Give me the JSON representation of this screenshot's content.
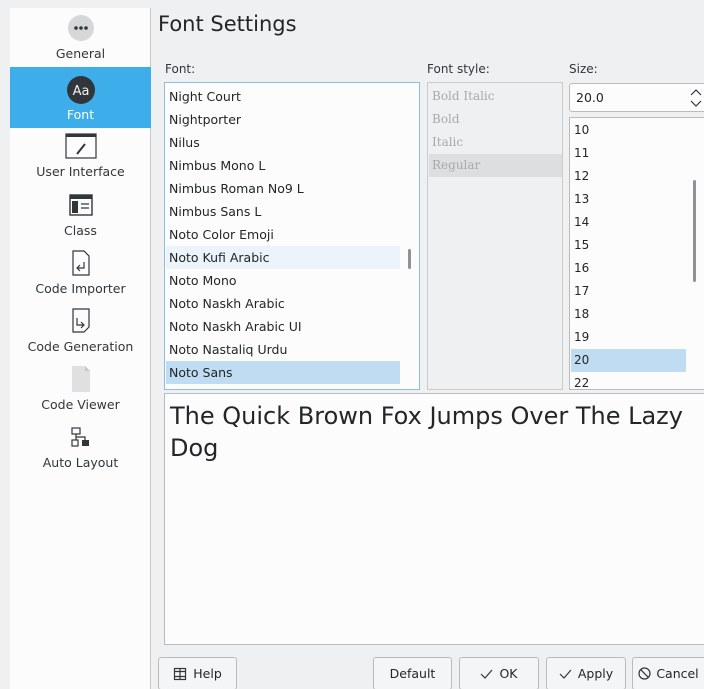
{
  "sidebar": {
    "items": [
      {
        "label": "General",
        "icon": "more-dots-icon"
      },
      {
        "label": "Font",
        "icon": "font-aa-icon",
        "active": true
      },
      {
        "label": "User Interface",
        "icon": "pencil-window-icon"
      },
      {
        "label": "Class",
        "icon": "class-diagram-icon"
      },
      {
        "label": "Code Importer",
        "icon": "import-arrow-icon"
      },
      {
        "label": "Code Generation",
        "icon": "export-arrow-icon"
      },
      {
        "label": "Code Viewer",
        "icon": "blank-document-icon"
      },
      {
        "label": "Auto Layout",
        "icon": "auto-layout-icon"
      }
    ]
  },
  "page": {
    "title": "Font Settings"
  },
  "labels": {
    "font": "Font:",
    "style": "Font style:",
    "size": "Size:"
  },
  "fonts": {
    "items": [
      "Night Court",
      "Nightporter",
      "Nilus",
      "Nimbus Mono L",
      "Nimbus Roman No9 L",
      "Nimbus Sans L",
      "Noto Color Emoji",
      "Noto Kufi Arabic",
      "Noto Mono",
      "Noto Naskh Arabic",
      "Noto Naskh Arabic UI",
      "Noto Nastaliq Urdu",
      "Noto Sans"
    ],
    "selected": "Noto Sans",
    "hovered": "Noto Kufi Arabic"
  },
  "styles": {
    "items": [
      "Bold Italic",
      "Bold",
      "Italic",
      "Regular"
    ],
    "selected": "Regular"
  },
  "size": {
    "value": "20.0",
    "items": [
      "10",
      "11",
      "12",
      "13",
      "14",
      "15",
      "16",
      "17",
      "18",
      "19",
      "20",
      "22"
    ],
    "selected": "20"
  },
  "preview": {
    "text": "The Quick Brown Fox Jumps Over The Lazy Dog"
  },
  "buttons": {
    "help": "Help",
    "default": "Default",
    "ok": "OK",
    "apply": "Apply",
    "cancel": "Cancel"
  },
  "colors": {
    "accent": "#3daee9",
    "selection": "#bfdcf2",
    "window_bg": "#eff0f1",
    "view_bg": "#fcfcfc"
  }
}
